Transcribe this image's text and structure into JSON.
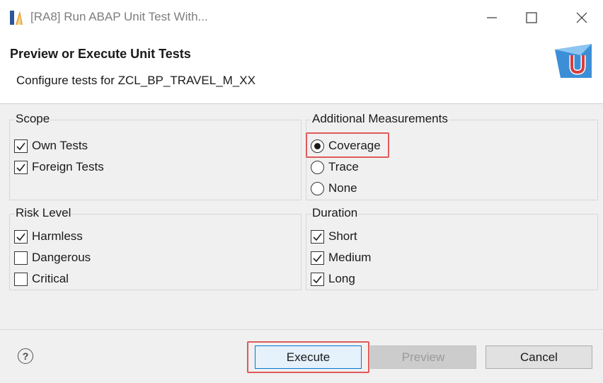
{
  "window": {
    "title": "[RA8]  Run ABAP Unit Test With...",
    "icons": {
      "app": "eclipse-app-icon",
      "minimize": "minimize-icon",
      "maximize": "maximize-icon",
      "close": "close-icon"
    }
  },
  "header": {
    "title": "Preview or Execute Unit Tests",
    "subtitle": "Configure tests for ZCL_BP_TRAVEL_M_XX",
    "logo": "abap-unit-logo-icon"
  },
  "scope": {
    "label": "Scope",
    "own_tests": {
      "label": "Own Tests",
      "checked": true
    },
    "foreign_tests": {
      "label": "Foreign Tests",
      "checked": true
    }
  },
  "measurements": {
    "label": "Additional Measurements",
    "coverage": {
      "label": "Coverage",
      "selected": true
    },
    "trace": {
      "label": "Trace",
      "selected": false
    },
    "none": {
      "label": "None",
      "selected": false
    }
  },
  "risk": {
    "label": "Risk Level",
    "harmless": {
      "label": "Harmless",
      "checked": true
    },
    "dangerous": {
      "label": "Dangerous",
      "checked": false
    },
    "critical": {
      "label": "Critical",
      "checked": false
    }
  },
  "duration": {
    "label": "Duration",
    "short": {
      "label": "Short",
      "checked": true
    },
    "medium": {
      "label": "Medium",
      "checked": true
    },
    "long": {
      "label": "Long",
      "checked": true
    }
  },
  "footer": {
    "help": "?",
    "execute": "Execute",
    "preview": "Preview",
    "cancel": "Cancel"
  },
  "colors": {
    "highlight": "#e05a5a",
    "dialog_bg": "#f0f0f0",
    "default_button_border": "#0078d7"
  }
}
